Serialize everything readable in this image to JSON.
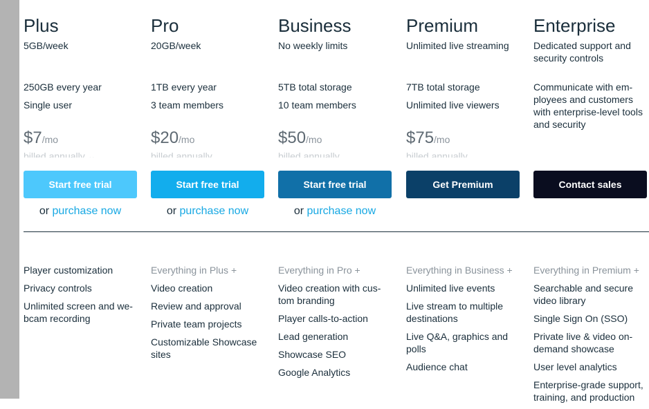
{
  "plans": [
    {
      "name": "Plus",
      "subtitle": "5GB/week",
      "specs": [
        "250GB every year",
        "Single user"
      ],
      "price": "$7",
      "per": "/mo",
      "billed": "billed annually ⌄",
      "button": {
        "label": "Start free trial",
        "color": "#4dc8fc"
      },
      "purchase": {
        "or": "or ",
        "link": "purchase now"
      },
      "features_header": "",
      "features": [
        "Player customization",
        "Privacy controls",
        "Unlimited screen and we-bcam recording"
      ]
    },
    {
      "name": "Pro",
      "subtitle": "20GB/week",
      "specs": [
        "1TB every year",
        "3 team members"
      ],
      "price": "$20",
      "per": "/mo",
      "billed": "billed annually",
      "button": {
        "label": "Start free trial",
        "color": "#12aded"
      },
      "purchase": {
        "or": "or ",
        "link": "purchase now"
      },
      "features_header": "Everything in Plus +",
      "features": [
        "Video creation",
        "Review and approval",
        "Private team projects",
        "Customizable Showcase sites"
      ]
    },
    {
      "name": "Business",
      "subtitle": "No weekly limits",
      "specs": [
        "5TB total storage",
        "10 team members"
      ],
      "price": "$50",
      "per": "/mo",
      "billed": "billed annually",
      "button": {
        "label": "Start free trial",
        "color": "#1170a8"
      },
      "purchase": {
        "or": "or ",
        "link": "purchase now"
      },
      "features_header": "Everything in Pro +",
      "features": [
        "Video creation with cus-tom branding",
        "Player calls-to-action",
        "Lead generation",
        "Showcase SEO",
        "Google Analytics"
      ]
    },
    {
      "name": "Premium",
      "subtitle": "Unlimited live streaming",
      "specs": [
        "7TB total storage",
        "Unlimited live viewers"
      ],
      "price": "$75",
      "per": "/mo",
      "billed": "billed annually",
      "button": {
        "label": "Get Premium",
        "color": "#0b4068"
      },
      "purchase": null,
      "features_header": "Everything in Business +",
      "features": [
        "Unlimited live events",
        "Live stream to multiple destinations",
        "Live Q&A, graphics and polls",
        "Audience chat"
      ]
    },
    {
      "name": "Enterprise",
      "subtitle": "Dedicated support and security controls",
      "description": "Communicate with em-ployees and customers with enterprise-level tools and security",
      "button": {
        "label": "Contact sales",
        "color": "#0a0d1f"
      },
      "features_header": "Everything in Premium +",
      "features": [
        "Searchable and secure video library",
        "Single Sign On (SSO)",
        "Private live & video on-demand showcase",
        "User level analytics",
        "Enterprise-grade support, training, and production"
      ]
    }
  ]
}
